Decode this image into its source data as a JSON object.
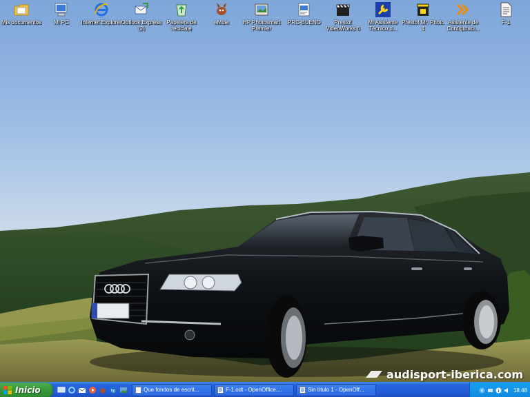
{
  "desktop_icons": [
    {
      "label": "Mis documentos",
      "icon": "folder-documents-icon"
    },
    {
      "label": "Mi PC",
      "icon": "my-computer-icon"
    },
    {
      "label": "Internet Explorer",
      "icon": "internet-explorer-icon"
    },
    {
      "label": "Outlook Express (2)",
      "icon": "outlook-express-icon"
    },
    {
      "label": "Papelera de reciclaje",
      "icon": "recycle-bin-icon"
    },
    {
      "label": "eMule",
      "icon": "emule-icon"
    },
    {
      "label": "HP Photosmart Premier",
      "icon": "hp-photosmart-icon"
    },
    {
      "label": "PRC-BUENO",
      "icon": "document-shortcut-icon"
    },
    {
      "label": "Presto! VideoWorks 6",
      "icon": "clapperboard-icon"
    },
    {
      "label": "Mi Asistente Técnico d...",
      "icon": "wrench-icon"
    },
    {
      "label": "Presto! Mr. Photo 4",
      "icon": "photo-clapper-icon"
    },
    {
      "label": "Asistente de Configuraci...",
      "icon": "wizard-arrows-icon"
    },
    {
      "label": "F-1",
      "icon": "text-document-icon"
    }
  ],
  "taskbar": {
    "start_label": "Inicio",
    "quick_launch": [
      "desktop-icon",
      "ie-quicklaunch-icon",
      "outlook-quicklaunch-icon",
      "media-icon",
      "emule-quicklaunch-icon",
      "hp-quicklaunch-icon",
      "photo-quicklaunch-icon"
    ],
    "buttons": [
      {
        "label": "Que fondos de escrit..."
      },
      {
        "label": "F-1.odt - OpenOffice...."
      },
      {
        "label": "Sin título 1 - OpenOff..."
      }
    ],
    "clock": "18:48",
    "colors": {
      "taskbar": "#245edb",
      "start": "#3a9c3e",
      "tray": "#0f89e0"
    }
  },
  "watermark": {
    "text": "audisport-iberica.com"
  }
}
